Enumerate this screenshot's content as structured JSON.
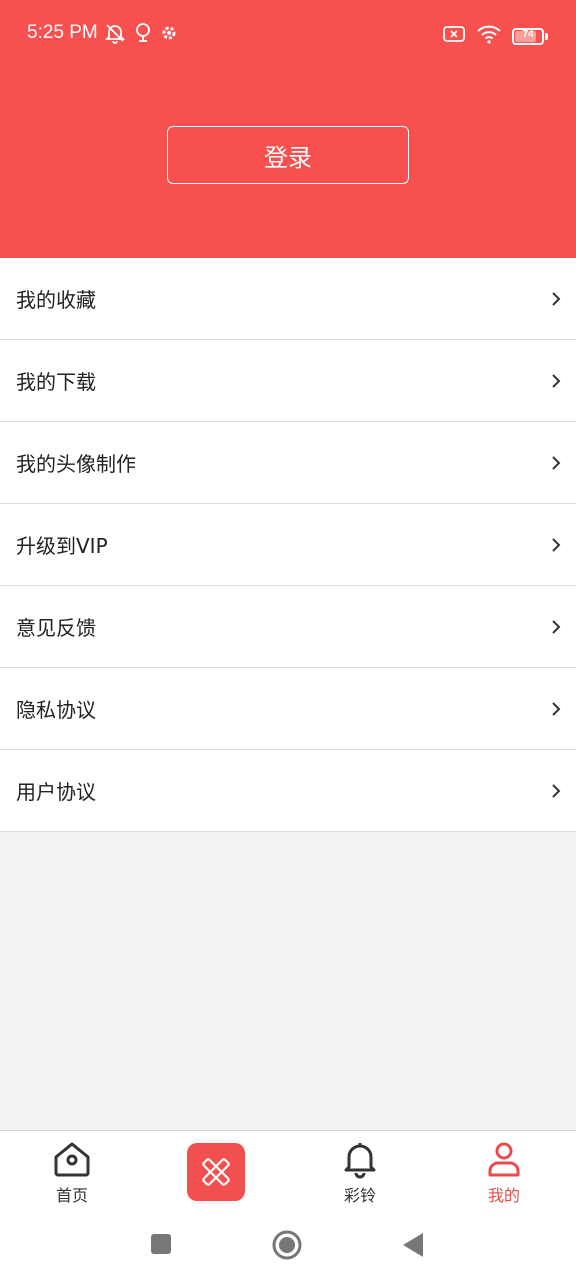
{
  "status_bar": {
    "time": "5:25 PM",
    "battery": "74",
    "icons": [
      "mute-icon",
      "location-icon",
      "settings-icon",
      "sim-off-icon",
      "wifi-icon",
      "battery-icon"
    ]
  },
  "header": {
    "login_label": "登录",
    "background_color": "#f84f4f"
  },
  "menu": {
    "items": [
      {
        "label": "我的收藏"
      },
      {
        "label": "我的下载"
      },
      {
        "label": "我的头像制作"
      },
      {
        "label": "升级到VIP"
      },
      {
        "label": "意见反馈"
      },
      {
        "label": "隐私协议"
      },
      {
        "label": "用户协议"
      }
    ]
  },
  "bottom_nav": {
    "items": [
      {
        "label": "首页",
        "icon": "home-icon"
      },
      {
        "label": "",
        "icon": "pencil-ruler-icon"
      },
      {
        "label": "彩铃",
        "icon": "bell-icon"
      },
      {
        "label": "我的",
        "icon": "user-icon",
        "active": true
      }
    ],
    "active_color": "#e64d4d"
  },
  "system_nav": {
    "icons": [
      "recents-icon",
      "home-circle-icon",
      "back-icon"
    ]
  }
}
